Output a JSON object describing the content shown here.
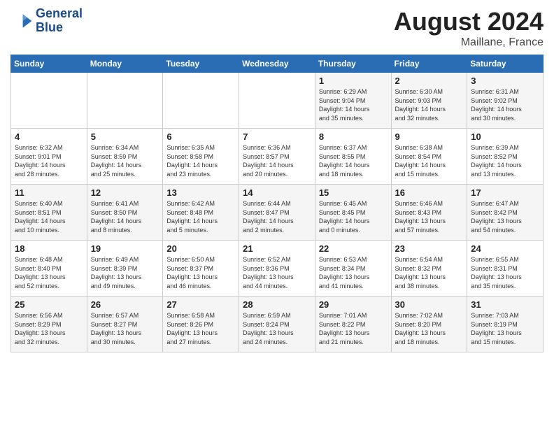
{
  "header": {
    "logo_line1": "General",
    "logo_line2": "Blue",
    "title": "August 2024",
    "subtitle": "Maillane, France"
  },
  "weekdays": [
    "Sunday",
    "Monday",
    "Tuesday",
    "Wednesday",
    "Thursday",
    "Friday",
    "Saturday"
  ],
  "weeks": [
    [
      {
        "day": "",
        "info": ""
      },
      {
        "day": "",
        "info": ""
      },
      {
        "day": "",
        "info": ""
      },
      {
        "day": "",
        "info": ""
      },
      {
        "day": "1",
        "info": "Sunrise: 6:29 AM\nSunset: 9:04 PM\nDaylight: 14 hours\nand 35 minutes."
      },
      {
        "day": "2",
        "info": "Sunrise: 6:30 AM\nSunset: 9:03 PM\nDaylight: 14 hours\nand 32 minutes."
      },
      {
        "day": "3",
        "info": "Sunrise: 6:31 AM\nSunset: 9:02 PM\nDaylight: 14 hours\nand 30 minutes."
      }
    ],
    [
      {
        "day": "4",
        "info": "Sunrise: 6:32 AM\nSunset: 9:01 PM\nDaylight: 14 hours\nand 28 minutes."
      },
      {
        "day": "5",
        "info": "Sunrise: 6:34 AM\nSunset: 8:59 PM\nDaylight: 14 hours\nand 25 minutes."
      },
      {
        "day": "6",
        "info": "Sunrise: 6:35 AM\nSunset: 8:58 PM\nDaylight: 14 hours\nand 23 minutes."
      },
      {
        "day": "7",
        "info": "Sunrise: 6:36 AM\nSunset: 8:57 PM\nDaylight: 14 hours\nand 20 minutes."
      },
      {
        "day": "8",
        "info": "Sunrise: 6:37 AM\nSunset: 8:55 PM\nDaylight: 14 hours\nand 18 minutes."
      },
      {
        "day": "9",
        "info": "Sunrise: 6:38 AM\nSunset: 8:54 PM\nDaylight: 14 hours\nand 15 minutes."
      },
      {
        "day": "10",
        "info": "Sunrise: 6:39 AM\nSunset: 8:52 PM\nDaylight: 14 hours\nand 13 minutes."
      }
    ],
    [
      {
        "day": "11",
        "info": "Sunrise: 6:40 AM\nSunset: 8:51 PM\nDaylight: 14 hours\nand 10 minutes."
      },
      {
        "day": "12",
        "info": "Sunrise: 6:41 AM\nSunset: 8:50 PM\nDaylight: 14 hours\nand 8 minutes."
      },
      {
        "day": "13",
        "info": "Sunrise: 6:42 AM\nSunset: 8:48 PM\nDaylight: 14 hours\nand 5 minutes."
      },
      {
        "day": "14",
        "info": "Sunrise: 6:44 AM\nSunset: 8:47 PM\nDaylight: 14 hours\nand 2 minutes."
      },
      {
        "day": "15",
        "info": "Sunrise: 6:45 AM\nSunset: 8:45 PM\nDaylight: 14 hours\nand 0 minutes."
      },
      {
        "day": "16",
        "info": "Sunrise: 6:46 AM\nSunset: 8:43 PM\nDaylight: 13 hours\nand 57 minutes."
      },
      {
        "day": "17",
        "info": "Sunrise: 6:47 AM\nSunset: 8:42 PM\nDaylight: 13 hours\nand 54 minutes."
      }
    ],
    [
      {
        "day": "18",
        "info": "Sunrise: 6:48 AM\nSunset: 8:40 PM\nDaylight: 13 hours\nand 52 minutes."
      },
      {
        "day": "19",
        "info": "Sunrise: 6:49 AM\nSunset: 8:39 PM\nDaylight: 13 hours\nand 49 minutes."
      },
      {
        "day": "20",
        "info": "Sunrise: 6:50 AM\nSunset: 8:37 PM\nDaylight: 13 hours\nand 46 minutes."
      },
      {
        "day": "21",
        "info": "Sunrise: 6:52 AM\nSunset: 8:36 PM\nDaylight: 13 hours\nand 44 minutes."
      },
      {
        "day": "22",
        "info": "Sunrise: 6:53 AM\nSunset: 8:34 PM\nDaylight: 13 hours\nand 41 minutes."
      },
      {
        "day": "23",
        "info": "Sunrise: 6:54 AM\nSunset: 8:32 PM\nDaylight: 13 hours\nand 38 minutes."
      },
      {
        "day": "24",
        "info": "Sunrise: 6:55 AM\nSunset: 8:31 PM\nDaylight: 13 hours\nand 35 minutes."
      }
    ],
    [
      {
        "day": "25",
        "info": "Sunrise: 6:56 AM\nSunset: 8:29 PM\nDaylight: 13 hours\nand 32 minutes."
      },
      {
        "day": "26",
        "info": "Sunrise: 6:57 AM\nSunset: 8:27 PM\nDaylight: 13 hours\nand 30 minutes."
      },
      {
        "day": "27",
        "info": "Sunrise: 6:58 AM\nSunset: 8:26 PM\nDaylight: 13 hours\nand 27 minutes."
      },
      {
        "day": "28",
        "info": "Sunrise: 6:59 AM\nSunset: 8:24 PM\nDaylight: 13 hours\nand 24 minutes."
      },
      {
        "day": "29",
        "info": "Sunrise: 7:01 AM\nSunset: 8:22 PM\nDaylight: 13 hours\nand 21 minutes."
      },
      {
        "day": "30",
        "info": "Sunrise: 7:02 AM\nSunset: 8:20 PM\nDaylight: 13 hours\nand 18 minutes."
      },
      {
        "day": "31",
        "info": "Sunrise: 7:03 AM\nSunset: 8:19 PM\nDaylight: 13 hours\nand 15 minutes."
      }
    ]
  ]
}
